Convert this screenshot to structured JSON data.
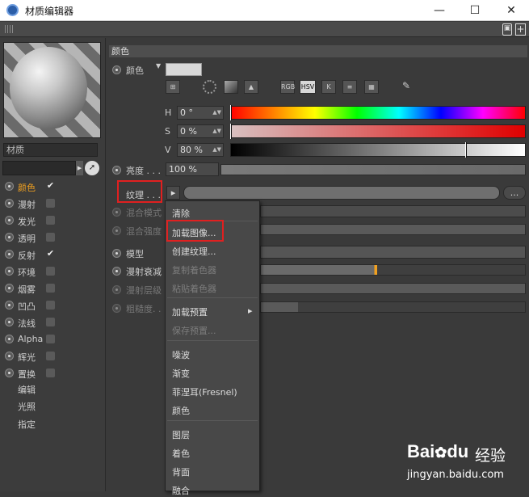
{
  "window": {
    "title": "材质编辑器",
    "minimize": "—",
    "maximize": "☐",
    "close": "✕"
  },
  "toolbar": {
    "lock": "🔒",
    "plus": "+"
  },
  "left": {
    "material_label": "材质",
    "channels": [
      {
        "label": "颜色",
        "checked": true,
        "active": true
      },
      {
        "label": "漫射",
        "checked": false
      },
      {
        "label": "发光",
        "checked": false
      },
      {
        "label": "透明",
        "checked": false
      },
      {
        "label": "反射",
        "checked": true
      },
      {
        "label": "环境",
        "checked": false
      },
      {
        "label": "烟雾",
        "checked": false
      },
      {
        "label": "凹凸",
        "checked": false
      },
      {
        "label": "法线",
        "checked": false
      },
      {
        "label": "Alpha",
        "checked": false
      },
      {
        "label": "辉光",
        "checked": false
      },
      {
        "label": "置换",
        "checked": false
      }
    ],
    "sub": [
      "编辑",
      "光照",
      "指定"
    ]
  },
  "color_section": {
    "header": "颜色",
    "color_label": "颜色",
    "swatch": "#d8d8d8",
    "mode_buttons": [
      "RGB",
      "HSV",
      "K"
    ],
    "h_label": "H",
    "h_value": "0 °",
    "s_label": "S",
    "s_value": "0 %",
    "v_label": "V",
    "v_value": "80 %",
    "h_marker": 0,
    "v_marker": 0.8,
    "brightness_label": "亮度 . . .",
    "brightness_value": "100 %",
    "texture_label": "纹理 . . .",
    "more_button": "...",
    "blend_mode_label": "混合模式",
    "blend_strength_label": "混合强度",
    "model_label": "模型",
    "diffuse_falloff_label": "漫射衰减",
    "diffuse_level_label": "漫射层级",
    "roughness_label": "粗糙度. . ."
  },
  "context_menu": {
    "items": [
      {
        "label": "清除",
        "disabled": false
      },
      {
        "label": "加载图像...",
        "disabled": false
      },
      {
        "label": "创建纹理...",
        "disabled": false
      },
      {
        "label": "复制着色器",
        "disabled": true
      },
      {
        "label": "粘贴着色器",
        "disabled": true
      },
      {
        "label": "加载预置",
        "disabled": false,
        "submenu": true
      },
      {
        "label": "保存预置...",
        "disabled": true
      },
      {
        "label": "噪波",
        "disabled": false
      },
      {
        "label": "渐变",
        "disabled": false
      },
      {
        "label": "菲涅耳(Fresnel)",
        "disabled": false
      },
      {
        "label": "颜色",
        "disabled": false
      },
      {
        "label": "图层",
        "disabled": false
      },
      {
        "label": "着色",
        "disabled": false
      },
      {
        "label": "背面",
        "disabled": false
      },
      {
        "label": "融合",
        "disabled": false
      }
    ],
    "submenu_arrow": "▸"
  },
  "watermark": {
    "brand": "Bai",
    "brand2": "du",
    "cn": "经验",
    "url": "jingyan.baidu.com"
  },
  "colors": {
    "accent": "#f0a020",
    "highlight_box": "#e02020"
  }
}
